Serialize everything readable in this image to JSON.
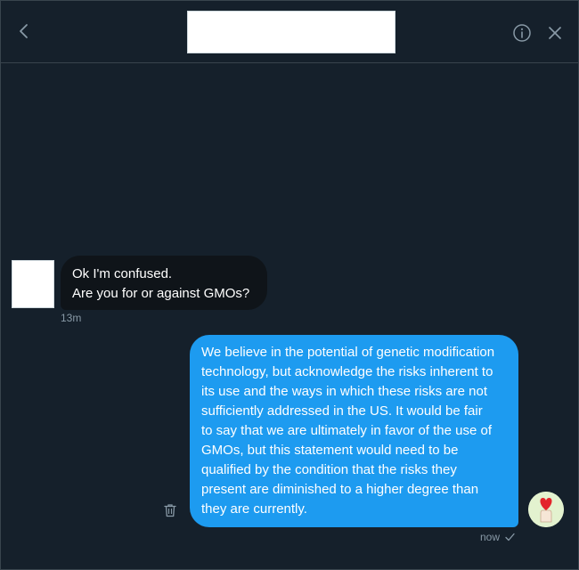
{
  "header": {
    "back_icon": "chevron-left-icon",
    "info_icon": "info-icon",
    "close_icon": "close-icon"
  },
  "messages": {
    "incoming": {
      "lines": [
        "Ok I'm confused.",
        "Are you for or against GMOs?"
      ],
      "time": "13m"
    },
    "outgoing": {
      "lines": [
        "We believe in the potential of genetic modification",
        "technology, but acknowledge the risks inherent to",
        "its use and the ways in which these risks are not",
        "sufficiently addressed in the US. It would be fair",
        "to say that we are ultimately in favor of the use of",
        "GMOs, but this statement would need to be",
        "qualified by the condition that the risks they",
        "present are diminished to a higher degree than",
        "they are currently."
      ],
      "time": "now",
      "status_icon": "checkmark-icon",
      "delete_icon": "trash-icon"
    }
  },
  "colors": {
    "background": "#15202b",
    "incoming_bubble": "#0f1419",
    "outgoing_bubble": "#1d9bf0",
    "muted_text": "#8899a6"
  }
}
